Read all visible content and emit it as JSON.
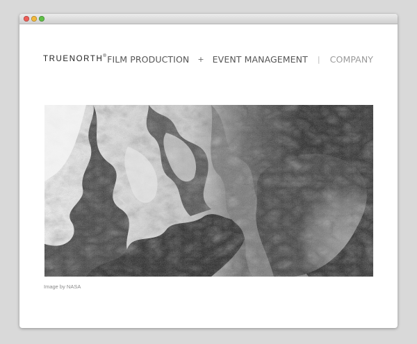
{
  "window": {
    "controls": [
      "close",
      "minimize",
      "maximize"
    ]
  },
  "brand": {
    "name": "TRUENORTH",
    "mark": "®"
  },
  "nav": {
    "items": [
      {
        "label": "FILM PRODUCTION"
      },
      {
        "label": "EVENT MANAGEMENT"
      },
      {
        "label": "COMPANY"
      }
    ],
    "separator_plus": "+",
    "separator_pipe": "|"
  },
  "hero": {
    "image_subject": "satellite-image-ice-and-coastline",
    "caption": "Image by NASA"
  },
  "colors": {
    "background": "#d9d9d9",
    "page": "#ffffff",
    "nav_text": "#555555",
    "nav_muted": "#999999"
  }
}
